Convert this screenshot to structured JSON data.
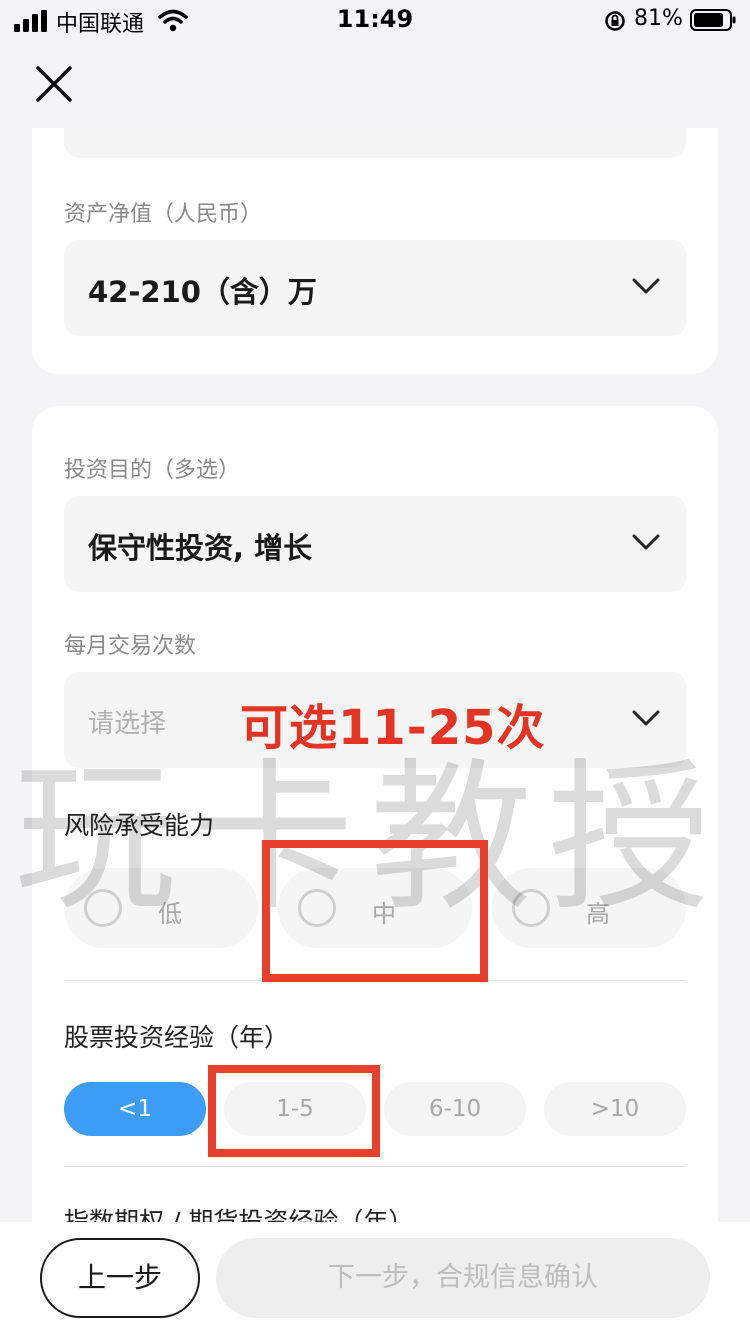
{
  "status_bar": {
    "carrier": "中国联通",
    "time": "11:49",
    "battery": "81%"
  },
  "form": {
    "net_assets": {
      "label": "资产净值（人民币）",
      "value": "42-210（含）万"
    },
    "investment_purpose": {
      "label": "投资目的（多选）",
      "value": "保守性投资, 增长"
    },
    "monthly_trades": {
      "label": "每月交易次数",
      "placeholder": "请选择"
    },
    "risk_tolerance": {
      "label": "风险承受能力",
      "options": [
        "低",
        "中",
        "高"
      ]
    },
    "stock_experience": {
      "label": "股票投资经验（年）",
      "options": [
        "<1",
        "1-5",
        "6-10",
        ">10"
      ],
      "selected": "<1"
    },
    "index_options_experience": {
      "label": "指数期权 / 期货投资经验（年）"
    }
  },
  "annotation": {
    "text": "可选11-25次",
    "watermark": "玩卡教授"
  },
  "footer": {
    "prev_label": "上一步",
    "next_label": "下一步，合规信息确认"
  },
  "colors": {
    "accent": "#3d9df6",
    "annotation_red": "#e53323"
  }
}
